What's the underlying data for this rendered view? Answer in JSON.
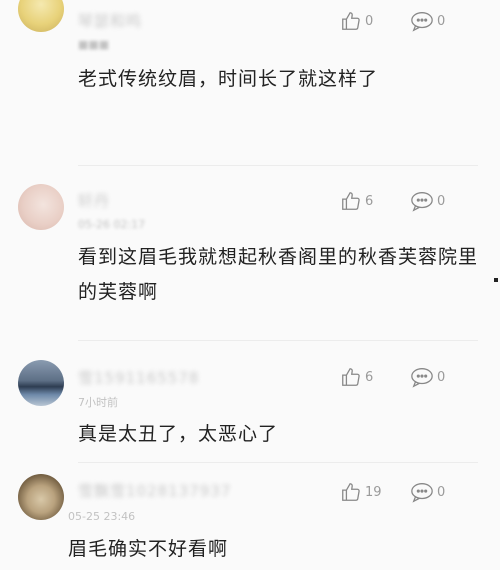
{
  "comments": [
    {
      "username": "琴瑟和鸣",
      "timestamp": "",
      "text": "老式传统纹眉，时间长了就这样了",
      "likes": "0",
      "replies": "0"
    },
    {
      "username": "轩丹",
      "timestamp": "05-26 02:17",
      "text": "看到这眉毛我就想起秋香阁里的秋香芙蓉院里的芙蓉啊",
      "likes": "6",
      "replies": "0"
    },
    {
      "username": "雪1591165578",
      "timestamp": "7小时前",
      "text": "真是太丑了，太恶心了",
      "likes": "6",
      "replies": "0"
    },
    {
      "username": "雪飘雪1028137937",
      "timestamp": "05-25 23:46",
      "text": "眉毛确实不好看啊",
      "likes": "19",
      "replies": "0"
    }
  ],
  "icons": {
    "like": "thumbs-up-icon",
    "reply": "comment-bubble-icon"
  }
}
